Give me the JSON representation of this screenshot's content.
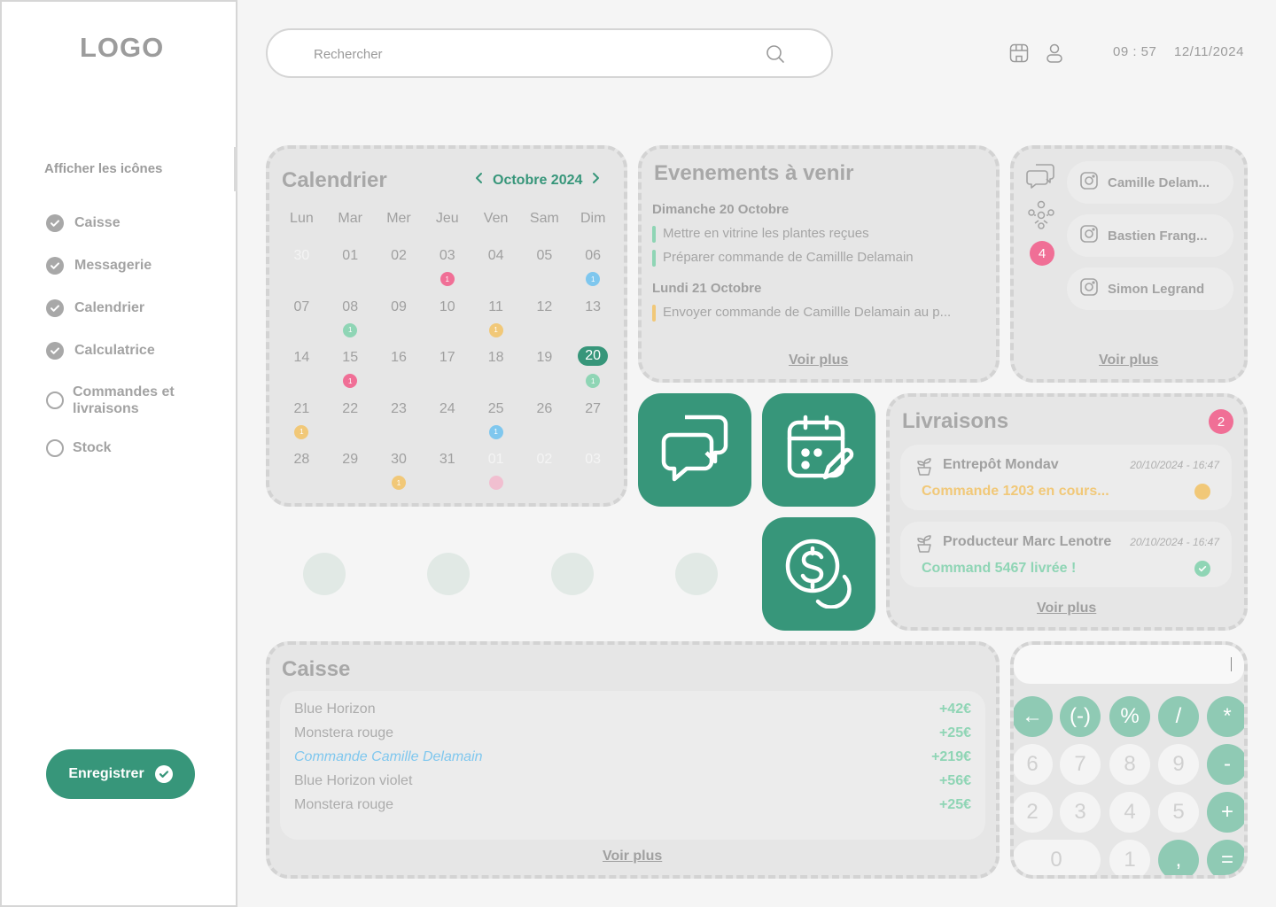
{
  "sidebar": {
    "logo": "LOGO",
    "heading": "Afficher les icônes",
    "options": [
      {
        "label": "Caisse",
        "checked": true
      },
      {
        "label": "Messagerie",
        "checked": true
      },
      {
        "label": "Calendrier",
        "checked": true
      },
      {
        "label": "Calculatrice",
        "checked": true
      },
      {
        "label_line1": "Commandes et",
        "label_line2": "livraisons",
        "checked": false
      },
      {
        "label": "Stock",
        "checked": false
      }
    ],
    "save_label": "Enregistrer"
  },
  "header": {
    "search_placeholder": "Rechercher",
    "time": "09 : 57",
    "date": "12/11/2024",
    "icons": [
      "store-icon",
      "user-icon",
      "search-icon"
    ]
  },
  "calendar": {
    "title": "Calendrier",
    "month": "Octobre 2024",
    "weekdays": [
      "Lun",
      "Mar",
      "Mer",
      "Jeu",
      "Ven",
      "Sam",
      "Dim"
    ],
    "weeks": [
      [
        {
          "d": "30",
          "m": true
        },
        {
          "d": "01"
        },
        {
          "d": "02"
        },
        {
          "d": "03",
          "dot": "pink",
          "n": "1"
        },
        {
          "d": "04"
        },
        {
          "d": "05"
        },
        {
          "d": "06",
          "dot": "blue",
          "n": "1"
        }
      ],
      [
        {
          "d": "07"
        },
        {
          "d": "08",
          "dot": "green",
          "n": "1"
        },
        {
          "d": "09"
        },
        {
          "d": "10"
        },
        {
          "d": "11",
          "dot": "yellow",
          "n": "1"
        },
        {
          "d": "12"
        },
        {
          "d": "13"
        }
      ],
      [
        {
          "d": "14"
        },
        {
          "d": "15",
          "dot": "pink",
          "n": "1"
        },
        {
          "d": "16"
        },
        {
          "d": "17"
        },
        {
          "d": "18"
        },
        {
          "d": "19"
        },
        {
          "d": "20",
          "today": true,
          "dot": "green",
          "n": "1"
        }
      ],
      [
        {
          "d": "21",
          "dot": "yellow",
          "n": "1"
        },
        {
          "d": "22"
        },
        {
          "d": "23"
        },
        {
          "d": "24"
        },
        {
          "d": "25",
          "dot": "blue",
          "n": "1"
        },
        {
          "d": "26"
        },
        {
          "d": "27"
        }
      ],
      [
        {
          "d": "28"
        },
        {
          "d": "29"
        },
        {
          "d": "30",
          "dot": "yellow",
          "n": "1"
        },
        {
          "d": "31"
        },
        {
          "d": "01",
          "m": true,
          "dot": "pinkl",
          "n": ""
        },
        {
          "d": "02",
          "m": true
        },
        {
          "d": "03",
          "m": true
        }
      ]
    ],
    "colors": {
      "accent": "#37967a",
      "pink": "#f06f96",
      "blue": "#7fc7ee",
      "green": "#8fd5b5",
      "yellow": "#f1c878"
    }
  },
  "events": {
    "title": "Evenements à venir",
    "day1": "Dimanche 20 Octobre",
    "day1_items": [
      "Mettre en vitrine les plantes reçues",
      "Préparer commande de Camillle Delamain"
    ],
    "day2": "Lundi 21 Octobre",
    "day2_items": [
      "Envoyer commande de Camillle Delamain au p..."
    ],
    "more": "Voir plus"
  },
  "messages": {
    "badge": "4",
    "contacts": [
      "Camille Delam...",
      "Bastien Frang...",
      "Simon Legrand"
    ],
    "more": "Voir plus"
  },
  "livraisons": {
    "title": "Livraisons",
    "badge": "2",
    "items": [
      {
        "name": "Entrepôt Mondav",
        "time": "20/10/2024 - 16:47",
        "status": "Commande 1203 en cours...",
        "state": "pending"
      },
      {
        "name": "Producteur Marc Lenotre",
        "time": "20/10/2024 - 16:47",
        "status": "Command 5467 livrée !",
        "state": "delivered"
      }
    ],
    "more": "Voir plus"
  },
  "caisse": {
    "title": "Caisse",
    "rows": [
      {
        "name": "Blue Horizon",
        "amount": "+42€"
      },
      {
        "name": "Monstera rouge",
        "amount": "+25€"
      },
      {
        "name": "Commande Camille Delamain",
        "amount": "+219€",
        "link": true
      },
      {
        "name": "Blue Horizon violet",
        "amount": "+56€"
      },
      {
        "name": "Monstera rouge",
        "amount": "+25€"
      }
    ],
    "more": "Voir plus"
  },
  "calculator": {
    "keys": [
      "←",
      "(-)",
      "%",
      "/",
      "*",
      "6",
      "7",
      "8",
      "9",
      "-",
      "2",
      "3",
      "4",
      "5",
      "+",
      "0",
      "1",
      ",",
      "="
    ]
  }
}
